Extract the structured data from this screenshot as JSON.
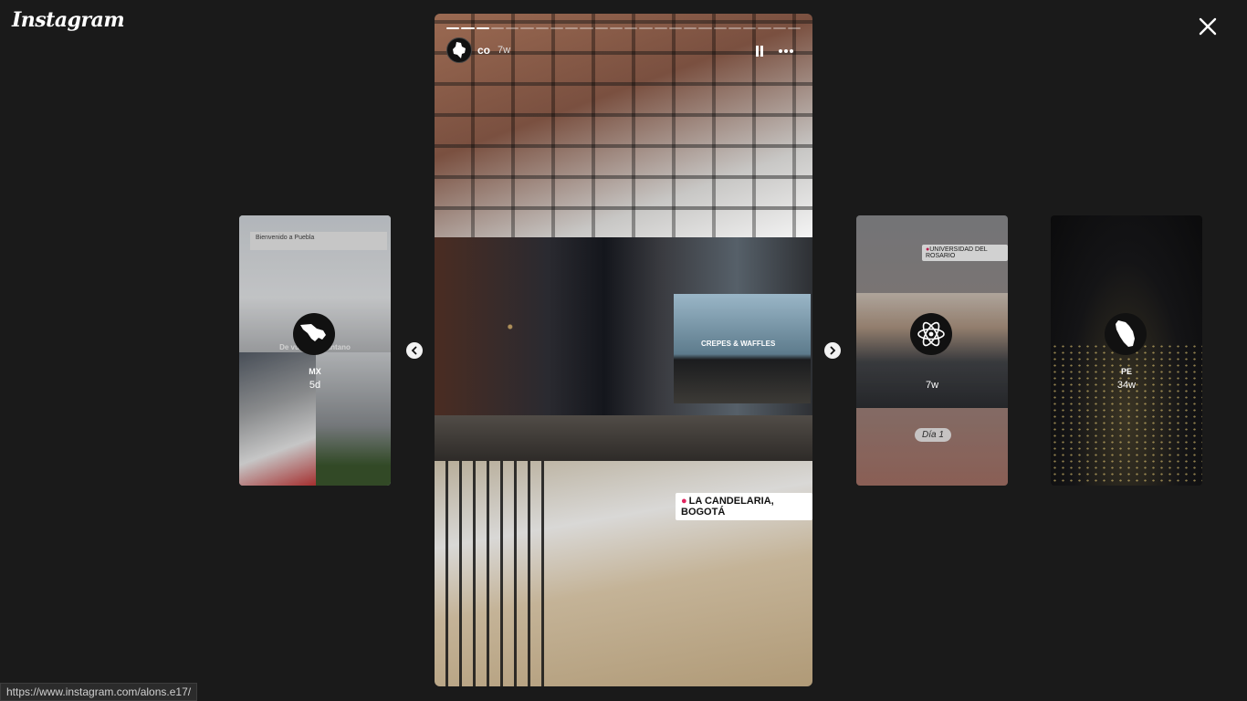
{
  "app": {
    "logo_text": "Instagram"
  },
  "stories_left": [
    {
      "user": "MX",
      "time": "5d",
      "sign_text": "Bienvenido a Puebla",
      "banner_text": "De vuelta al pantano"
    }
  ],
  "stories_right": [
    {
      "user": "",
      "time": "7w",
      "location_tag": "UNIVERSIDAD DEL ROSARIO",
      "caption": "Día 1"
    },
    {
      "user": "PE",
      "time": "34w"
    }
  ],
  "active_story": {
    "user": "co",
    "time": "7w",
    "segments_total": 24,
    "segments_done": 3,
    "location_tag": "LA CANDELARIA, BOGOTÁ",
    "shop_sign": "CREPES & WAFFLES"
  },
  "status_bar": {
    "url": "https://www.instagram.com/alons.e17/"
  },
  "colors": {
    "background": "#1a1a1a",
    "text": "#ffffff"
  }
}
